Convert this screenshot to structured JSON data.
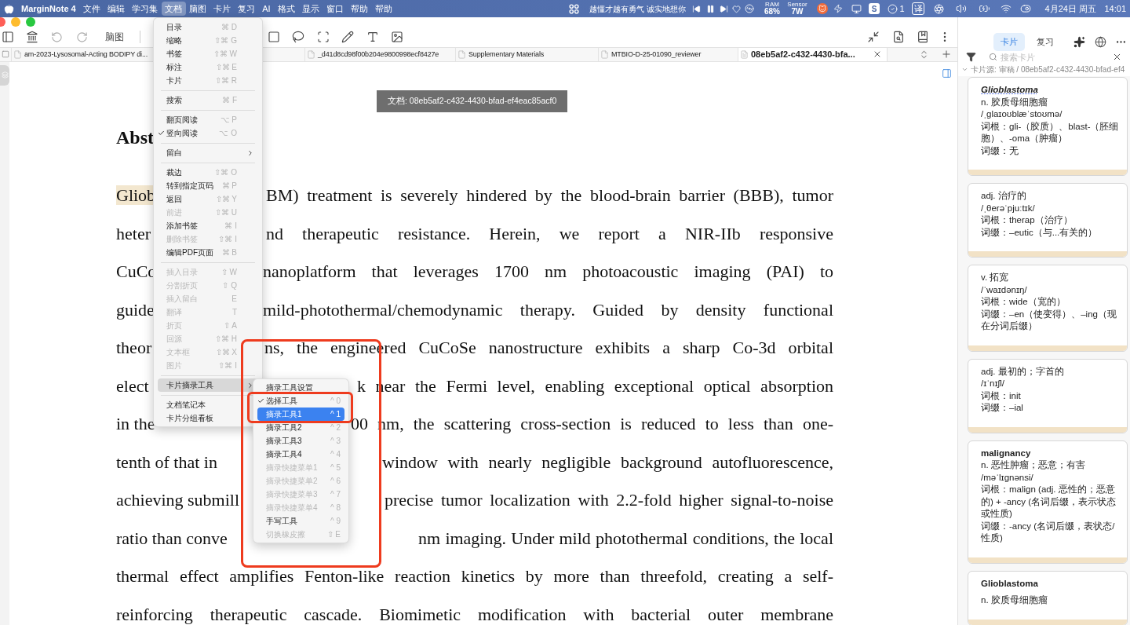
{
  "menu_bar": {
    "app": "MarginNote 4",
    "items": [
      {
        "label": "文件",
        "selected": false
      },
      {
        "label": "编辑",
        "selected": false
      },
      {
        "label": "学习集",
        "selected": false
      },
      {
        "label": "文档",
        "selected": true
      },
      {
        "label": "脑图",
        "selected": false
      },
      {
        "label": "卡片",
        "selected": false
      },
      {
        "label": "复习",
        "selected": false
      },
      {
        "label": "AI",
        "selected": false
      },
      {
        "label": "格式",
        "selected": false
      },
      {
        "label": "显示",
        "selected": false
      },
      {
        "label": "窗口",
        "selected": false
      },
      {
        "label": "帮助",
        "selected": false
      },
      {
        "label": "帮助",
        "selected": false
      }
    ],
    "status": {
      "lyrics": "越懂才越有勇气 诚实地想你",
      "ram_label": "RAM",
      "ram_value": "68%",
      "sensor_label": "Sensor",
      "sensor_value": "7W",
      "s_badge": "S",
      "task_count": "1",
      "translate_badge": "译",
      "date": "4月24日 周五",
      "time": "14:01"
    }
  },
  "toolbar": {
    "mindmap_label": "脑图"
  },
  "tabs": [
    {
      "title": "am-2023-Lysosomal-Acting BODIPY di...",
      "selected": false
    },
    {
      "title": "_d41d8cd98f00b204e9800998ecf8427e",
      "selected": false
    },
    {
      "title": "Supplementary Materials",
      "selected": false
    },
    {
      "title": "MTBIO-D-25-01090_reviewer",
      "selected": false
    },
    {
      "title": "08eb5af2-c432-4430-bfa...",
      "selected": true
    }
  ],
  "tooltip": "文档: 08eb5af2-c432-4430-bfad-ef4eac85acf0",
  "document": {
    "heading": "Abst",
    "lines": [
      {
        "kind": "split",
        "left": "Gliob",
        "right": "BM) treatment is severely hindered by the blood-brain barrier (BBB), tumor",
        "highlighted": true
      },
      {
        "kind": "split",
        "left": "heter",
        "right": "nd therapeutic resistance. Herein, we report a NIR-IIb responsive",
        "highlighted": false
      },
      {
        "kind": "split",
        "left": "CuCo",
        "right": "nanoplatform that leverages 1700 nm photoacoustic imaging (PAI) to",
        "highlighted": false
      },
      {
        "kind": "split",
        "left": "guide",
        "right": "mild-photothermal/chemodynamic therapy. Guided by density functional",
        "highlighted": false
      },
      {
        "kind": "split",
        "left": "theor",
        "right": "ns, the engineered CuCoSe nanostructure exhibits a sharp Co-3d orbital",
        "highlighted": false
      },
      {
        "kind": "split",
        "left": "elect",
        "right": "k near the Fermi level, enabling exceptional optical absorption",
        "highlighted": false
      },
      {
        "kind": "split",
        "left": "in the",
        "right": "00 nm, the scattering cross-section is reduced to less than one-",
        "highlighted": false
      },
      {
        "kind": "split",
        "left": "tenth of that in",
        "right": "window with nearly negligible background autofluorescence,",
        "highlighted": false
      },
      {
        "kind": "split",
        "left": "achieving submill",
        "right": "precise tumor localization with 2.2-fold higher signal-to-noise",
        "highlighted": false
      },
      {
        "kind": "split",
        "left": "ratio than conve",
        "right": "nm imaging. Under mild photothermal conditions, the local",
        "highlighted": false
      },
      {
        "kind": "full",
        "text": "thermal effect amplifies Fenton-like reaction kinetics by more than threefold, creating a self-",
        "highlighted": false
      },
      {
        "kind": "full",
        "text": "reinforcing therapeutic cascade. Biomimetic modification with bacterial outer membrane",
        "highlighted": false
      }
    ]
  },
  "doc_menu": {
    "sections": [
      {
        "items": [
          {
            "label": "目录",
            "shortcut": "⌘ D",
            "checked": false,
            "disabled": false,
            "highlighted": false,
            "has_submenu": false
          },
          {
            "label": "缩略",
            "shortcut": "⇧⌘ G",
            "checked": false,
            "disabled": false,
            "highlighted": false,
            "has_submenu": false
          },
          {
            "label": "书签",
            "shortcut": "⇧⌘ W",
            "checked": false,
            "disabled": false,
            "highlighted": false,
            "has_submenu": false
          },
          {
            "label": "标注",
            "shortcut": "⇧⌘ E",
            "checked": false,
            "disabled": false,
            "highlighted": false,
            "has_submenu": false
          },
          {
            "label": "卡片",
            "shortcut": "⇧⌘ R",
            "checked": false,
            "disabled": false,
            "highlighted": false,
            "has_submenu": false
          }
        ]
      },
      {
        "items": [
          {
            "label": "搜索",
            "shortcut": "⌘ F",
            "checked": false,
            "disabled": false,
            "highlighted": false,
            "has_submenu": false
          }
        ]
      },
      {
        "items": [
          {
            "label": "翻页阅读",
            "shortcut": "⌥ P",
            "checked": false,
            "disabled": false,
            "highlighted": false,
            "has_submenu": false
          },
          {
            "label": "竖向阅读",
            "shortcut": "⌥ O",
            "checked": true,
            "disabled": false,
            "highlighted": false,
            "has_submenu": false
          }
        ]
      },
      {
        "items": [
          {
            "label": "留白",
            "checked": false,
            "disabled": false,
            "highlighted": false,
            "has_submenu": true
          }
        ]
      },
      {
        "items": [
          {
            "label": "裁边",
            "shortcut": "⇧⌘ O",
            "checked": false,
            "disabled": false,
            "highlighted": false,
            "has_submenu": false
          },
          {
            "label": "转到指定页码",
            "shortcut": "⌘ P",
            "checked": false,
            "disabled": false,
            "highlighted": false,
            "has_submenu": false
          },
          {
            "label": "返回",
            "shortcut": "⇧⌘ Y",
            "checked": false,
            "disabled": false,
            "highlighted": false,
            "has_submenu": false
          },
          {
            "label": "前进",
            "shortcut": "⇧⌘ U",
            "checked": false,
            "disabled": true,
            "highlighted": false,
            "has_submenu": false
          },
          {
            "label": "添加书签",
            "shortcut": "⌘ I",
            "checked": false,
            "disabled": false,
            "highlighted": false,
            "has_submenu": false
          },
          {
            "label": "删除书签",
            "shortcut": "⇧⌘ I",
            "checked": false,
            "disabled": true,
            "highlighted": false,
            "has_submenu": false
          },
          {
            "label": "编辑PDF页面",
            "shortcut": "⌘ B",
            "checked": false,
            "disabled": false,
            "highlighted": false,
            "has_submenu": false
          }
        ]
      },
      {
        "items": [
          {
            "label": "插入目录",
            "shortcut": "⇧ W",
            "checked": false,
            "disabled": true,
            "highlighted": false,
            "has_submenu": false
          },
          {
            "label": "分割折页",
            "shortcut": "⇧ Q",
            "checked": false,
            "disabled": true,
            "highlighted": false,
            "has_submenu": false
          },
          {
            "label": "插入留白",
            "shortcut": "E",
            "checked": false,
            "disabled": true,
            "highlighted": false,
            "has_submenu": false
          },
          {
            "label": "翻译",
            "shortcut": "T",
            "checked": false,
            "disabled": true,
            "highlighted": false,
            "has_submenu": false
          },
          {
            "label": "折页",
            "shortcut": "⇧ A",
            "checked": false,
            "disabled": true,
            "highlighted": false,
            "has_submenu": false
          },
          {
            "label": "回源",
            "shortcut": "⇧⌘ H",
            "checked": false,
            "disabled": true,
            "highlighted": false,
            "has_submenu": false
          },
          {
            "label": "文本框",
            "shortcut": "⇧⌘ X",
            "checked": false,
            "disabled": true,
            "highlighted": false,
            "has_submenu": false
          },
          {
            "label": "图片",
            "shortcut": "⇧⌘ I",
            "checked": false,
            "disabled": true,
            "highlighted": false,
            "has_submenu": false
          }
        ]
      },
      {
        "items": [
          {
            "label": "卡片摘录工具",
            "checked": false,
            "disabled": false,
            "highlighted": true,
            "has_submenu": true
          }
        ]
      },
      {
        "items": [
          {
            "label": "文档笔记本",
            "checked": false,
            "disabled": false,
            "highlighted": false,
            "has_submenu": false
          },
          {
            "label": "卡片分组看板",
            "checked": false,
            "disabled": false,
            "highlighted": false,
            "has_submenu": false
          }
        ]
      }
    ]
  },
  "submenu": {
    "items": [
      {
        "label": "摘录工具设置",
        "checked": false,
        "disabled": false,
        "selected": false
      },
      {
        "label": "选择工具",
        "shortcut": "^ 0",
        "checked": true,
        "disabled": false,
        "selected": false
      },
      {
        "label": "摘录工具1",
        "shortcut": "^ 1",
        "checked": false,
        "disabled": false,
        "selected": true
      },
      {
        "label": "摘录工具2",
        "shortcut": "^ 2",
        "checked": false,
        "disabled": false,
        "selected": false
      },
      {
        "label": "摘录工具3",
        "shortcut": "^ 3",
        "checked": false,
        "disabled": false,
        "selected": false
      },
      {
        "label": "摘录工具4",
        "shortcut": "^ 4",
        "checked": false,
        "disabled": false,
        "selected": false
      },
      {
        "label": "摘录快捷菜单1",
        "shortcut": "^ 5",
        "checked": false,
        "disabled": true,
        "selected": false
      },
      {
        "label": "摘录快捷菜单2",
        "shortcut": "^ 6",
        "checked": false,
        "disabled": true,
        "selected": false
      },
      {
        "label": "摘录快捷菜单3",
        "shortcut": "^ 7",
        "checked": false,
        "disabled": true,
        "selected": false
      },
      {
        "label": "摘录快捷菜单4",
        "shortcut": "^ 8",
        "checked": false,
        "disabled": true,
        "selected": false
      },
      {
        "label": "手写工具",
        "shortcut": "^ 9",
        "checked": false,
        "disabled": false,
        "selected": false
      },
      {
        "label": "切换橡皮擦",
        "shortcut": "⇧ E",
        "checked": false,
        "disabled": true,
        "selected": false
      }
    ]
  },
  "cards_panel": {
    "tabs": [
      {
        "label": "卡片",
        "selected": true
      },
      {
        "label": "复习",
        "selected": false
      }
    ],
    "search_placeholder": "搜索卡片",
    "breadcrumb": "卡片源: 审稿 / 08eb5af2-c432-4430-bfad-ef4",
    "cards": [
      {
        "title": "Glioblastoma",
        "italic": true,
        "lines": [
          "n. 胶质母细胞瘤",
          "/ˌɡlaɪoʊblæˈstoʊmə/",
          "词根：gli-（胶质）、blast-（胚细胞）、-oma（肿瘤）",
          "词缀：无"
        ]
      },
      {
        "lines": [
          "adj. 治疗的",
          "/ˌθerəˈpjuːtɪk/",
          "词根：therap（治疗）",
          "词缀：–eutic（与...有关的）"
        ]
      },
      {
        "lines": [
          "v. 拓宽",
          "/ˈwaɪdənɪŋ/",
          "词根：wide（宽的）",
          "词缀：–en（使变得）、–ing（现在分词后缀）"
        ]
      },
      {
        "lines": [
          "adj. 最初的；字首的",
          "/ɪˈnɪʃl/",
          "词根：init",
          "词缀：–ial"
        ]
      },
      {
        "title": "malignancy",
        "italic": false,
        "lines": [
          "n. 恶性肿瘤；恶意；有害",
          "/məˈlɪgnənsi/",
          "词根：malign (adj. 恶性的；恶意的) + -ancy (名词后缀，表示状态或性质)",
          "词缀：-ancy (名词后缀，表状态/性质)"
        ]
      },
      {
        "title": "Glioblastoma",
        "italic": false,
        "lines": [
          "n. 胶质母细胞瘤"
        ]
      }
    ]
  }
}
